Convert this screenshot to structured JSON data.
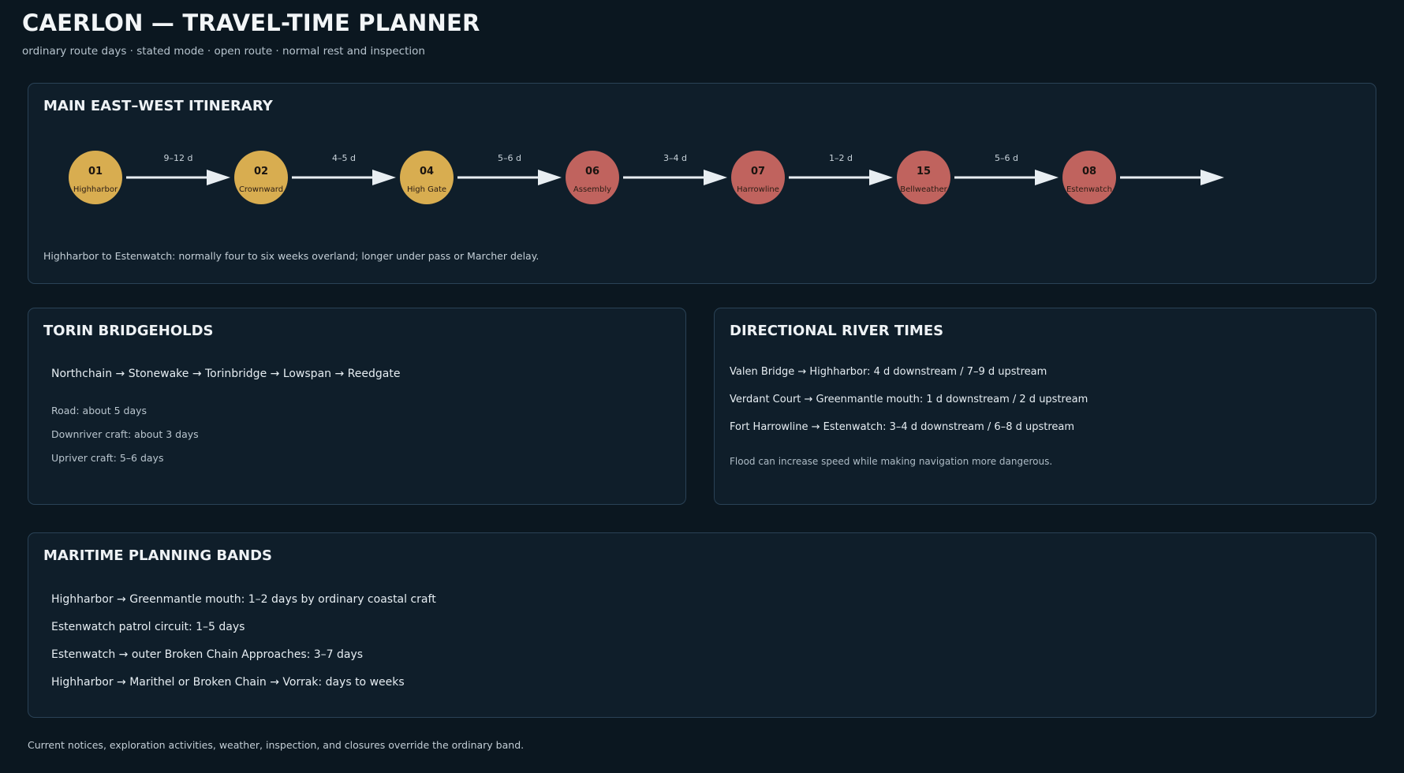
{
  "header": {
    "title": "CAERLON — TRAVEL-TIME PLANNER",
    "subtitle": "ordinary route days · stated mode · open route · normal rest and inspection"
  },
  "itinerary": {
    "title": "MAIN EAST–WEST ITINERARY",
    "stops": [
      {
        "id": "01",
        "name": "Highharbor",
        "color": "#d8ad50"
      },
      {
        "id": "02",
        "name": "Crownward",
        "color": "#d8ad50"
      },
      {
        "id": "04",
        "name": "High Gate",
        "color": "#d8ad50"
      },
      {
        "id": "06",
        "name": "Assembly",
        "color": "#c0635e"
      },
      {
        "id": "07",
        "name": "Harrowline",
        "color": "#c0635e"
      },
      {
        "id": "15",
        "name": "Bellweather",
        "color": "#c0635e"
      },
      {
        "id": "08",
        "name": "Estenwatch",
        "color": "#c0635e"
      }
    ],
    "legs": [
      "9–12 d",
      "4–5 d",
      "5–6 d",
      "3–4 d",
      "1–2 d",
      "5–6 d"
    ],
    "note": "Highharbor to Estenwatch: normally four to six weeks overland; longer under pass or Marcher delay."
  },
  "torin": {
    "title": "TORIN BRIDGEHOLDS",
    "route": "Northchain → Stonewake → Torinbridge → Lowspan → Reedgate",
    "modes": [
      "Road: about 5 days",
      "Downriver craft: about 3 days",
      "Upriver craft: 5–6 days"
    ]
  },
  "river": {
    "title": "DIRECTIONAL RIVER TIMES",
    "items": [
      "Valen Bridge → Highharbor: 4 d downstream / 7–9 d upstream",
      "Verdant Court → Greenmantle mouth: 1 d downstream / 2 d upstream",
      "Fort Harrowline → Estenwatch: 3–4 d downstream / 6–8 d upstream"
    ],
    "note": "Flood can increase speed while making navigation more dangerous."
  },
  "maritime": {
    "title": "MARITIME PLANNING BANDS",
    "items": [
      "Highharbor → Greenmantle mouth: 1–2 days by ordinary coastal craft",
      "Estenwatch patrol circuit: 1–5 days",
      "Estenwatch → outer Broken Chain Approaches: 3–7 days",
      "Highharbor → Marithel or Broken Chain → Vorrak: days to weeks"
    ]
  },
  "footer": {
    "note": "Current notices, exploration activities, weather, inspection, and closures override the ordinary band."
  }
}
